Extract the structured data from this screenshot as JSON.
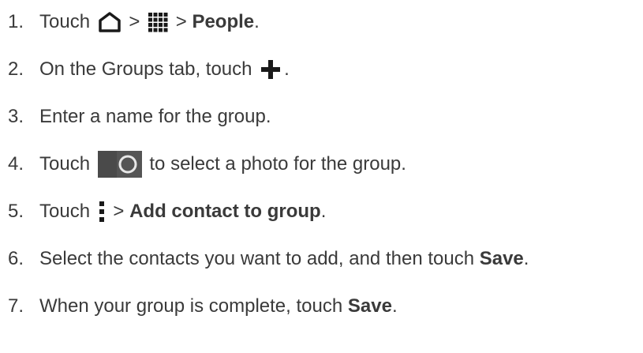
{
  "steps": [
    {
      "number": "1.",
      "parts": [
        "Touch ",
        " > ",
        " > ",
        "People",
        "."
      ]
    },
    {
      "number": "2.",
      "parts": [
        "On the Groups tab, touch ",
        "."
      ]
    },
    {
      "number": "3.",
      "parts": [
        "Enter a name for the group."
      ]
    },
    {
      "number": "4.",
      "parts": [
        "Touch ",
        " to select a photo for the group."
      ]
    },
    {
      "number": "5.",
      "parts": [
        "Touch ",
        " > ",
        "Add contact to group",
        "."
      ]
    },
    {
      "number": "6.",
      "parts": [
        "Select the contacts you want to add, and then touch ",
        "Save",
        "."
      ]
    },
    {
      "number": "7.",
      "parts": [
        "When your group is complete, touch ",
        "Save",
        "."
      ]
    }
  ],
  "icons": {
    "home": "home-icon",
    "apps": "apps-grid-icon",
    "add": "plus-icon",
    "camera": "camera-icon",
    "menu": "overflow-menu-icon"
  },
  "colors": {
    "text": "#3a3a3a",
    "icon": "#1a1a1a",
    "camera_bg": "#555555"
  }
}
